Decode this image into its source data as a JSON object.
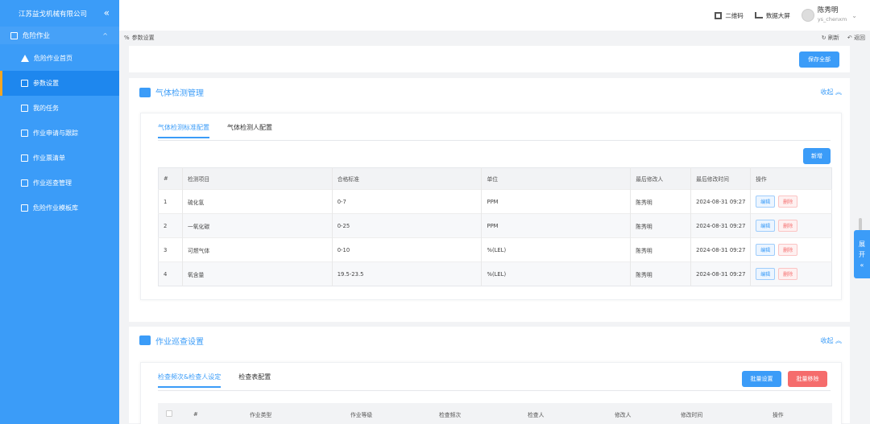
{
  "sidebar": {
    "company": "江苏益戈机械有限公司",
    "collapse_icon": "«",
    "group": "危险作业",
    "items": [
      {
        "label": "危险作业首页",
        "icon": "warning-icon"
      },
      {
        "label": "参数设置",
        "icon": "doc-icon"
      },
      {
        "label": "我的任务",
        "icon": "doc-icon"
      },
      {
        "label": "作业申请与跟踪",
        "icon": "doc-icon"
      },
      {
        "label": "作业票清单",
        "icon": "doc-icon"
      },
      {
        "label": "作业巡查管理",
        "icon": "doc-icon"
      },
      {
        "label": "危险作业模板库",
        "icon": "doc-icon"
      }
    ]
  },
  "header": {
    "qrcode": "二维码",
    "dashboard": "数据大屏",
    "user_name": "陈秀明",
    "user_id": "ys_chenxm"
  },
  "breadcrumb": {
    "current": "参数设置",
    "refresh": "刷新",
    "back": "返回"
  },
  "save_all": "保存全部",
  "gas_section": {
    "title": "气体检测管理",
    "fold": "收起",
    "tabs": [
      "气体检测标准配置",
      "气体检测人配置"
    ],
    "add": "新增",
    "columns": [
      "#",
      "检测项目",
      "合格标准",
      "单位",
      "最后修改人",
      "最后修改时间",
      "操作"
    ],
    "rows": [
      [
        "1",
        "硫化氢",
        "0-7",
        "PPM",
        "陈秀明",
        "2024-08-31 09:27"
      ],
      [
        "2",
        "一氧化碳",
        "0-25",
        "PPM",
        "陈秀明",
        "2024-08-31 09:27"
      ],
      [
        "3",
        "可燃气体",
        "0-10",
        "%(LEL)",
        "陈秀明",
        "2024-08-31 09:27"
      ],
      [
        "4",
        "氧含量",
        "19.5-23.5",
        "%(LEL)",
        "陈秀明",
        "2024-08-31 09:27"
      ]
    ],
    "edit": "编辑",
    "delete": "删除"
  },
  "patrol_section": {
    "title": "作业巡查设置",
    "fold": "收起",
    "tabs": [
      "检查频次&检查人设定",
      "检查表配置"
    ],
    "batch_set": "批量设置",
    "batch_delete": "批量移除",
    "columns": [
      "#",
      "作业类型",
      "作业等级",
      "检查频次",
      "检查人",
      "修改人",
      "修改时间",
      "操作"
    ]
  },
  "expand": {
    "line1": "展",
    "line2": "开",
    "line3": "«"
  }
}
